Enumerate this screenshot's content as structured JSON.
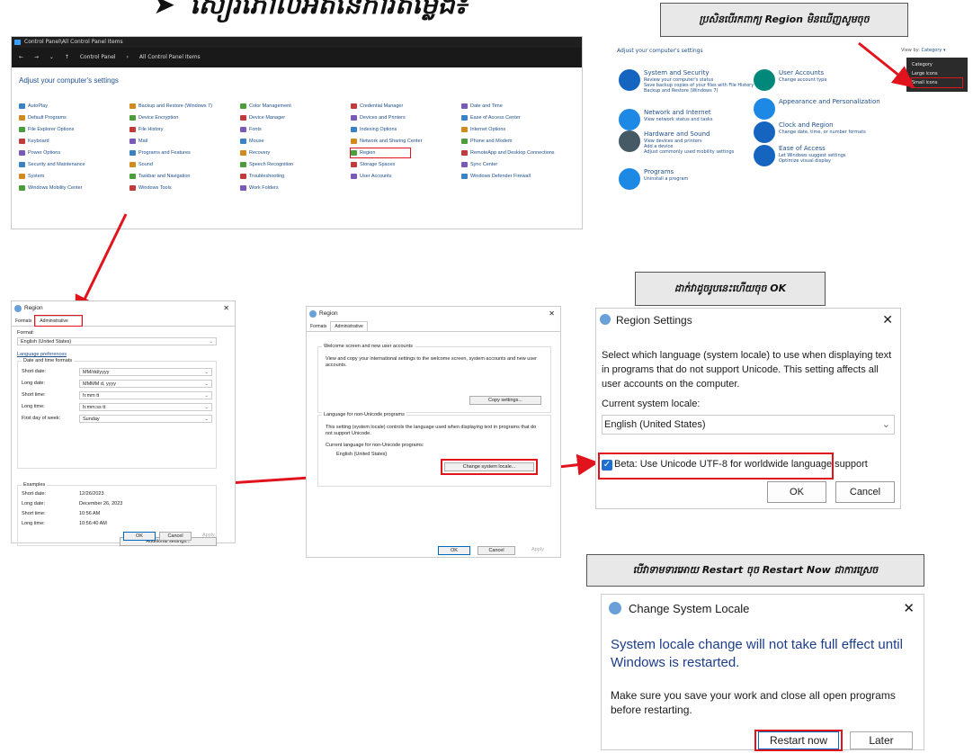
{
  "headline": {
    "arrow": "➤",
    "text": "សៀវភៅលំអិតនៃការតម្លើង៖"
  },
  "control_panel": {
    "window_title": "Control Panel\\All Control Panel Items",
    "breadcrumb": [
      "Control Panel",
      "All Control Panel Items"
    ],
    "heading": "Adjust your computer's settings",
    "items": [
      [
        "AutoPlay",
        "Backup and Restore (Windows 7)",
        "Color Management",
        "Credential Manager",
        "Date and Time"
      ],
      [
        "Default Programs",
        "Device Encryption",
        "Device Manager",
        "Devices and Printers",
        "Ease of Access Center"
      ],
      [
        "File Explorer Options",
        "File History",
        "Fonts",
        "Indexing Options",
        "Internet Options"
      ],
      [
        "Keyboard",
        "Mail",
        "Mouse",
        "Network and Sharing Center",
        "Phone and Modem"
      ],
      [
        "Power Options",
        "Programs and Features",
        "Recovery",
        "Region",
        "RemoteApp and Desktop Connections"
      ],
      [
        "Security and Maintenance",
        "Sound",
        "Speech Recognition",
        "Storage Spaces",
        "Sync Center"
      ],
      [
        "System",
        "Taskbar and Navigation",
        "Troubleshooting",
        "User Accounts",
        "Windows Defender Firewall"
      ],
      [
        "Windows Mobility Center",
        "Windows Tools",
        "Work Folders",
        "",
        ""
      ]
    ]
  },
  "banner1": "ប្រសិនបើរកពាក្យ Region មិនឃើញសូមចុច",
  "category_panel": {
    "heading": "Adjust your computer's settings",
    "view_by_label": "View by:",
    "view_by_value": "Category ▾",
    "menu": [
      "Category",
      "Large icons",
      "Small icons"
    ],
    "groups": [
      {
        "title": "System and Security",
        "links": [
          "Review your computer's status",
          "Save backup copies of your files with File History",
          "Backup and Restore (Windows 7)"
        ]
      },
      {
        "title": "Network and Internet",
        "links": [
          "View network status and tasks"
        ]
      },
      {
        "title": "Hardware and Sound",
        "links": [
          "View devices and printers",
          "Add a device",
          "Adjust commonly used mobility settings"
        ]
      },
      {
        "title": "Programs",
        "links": [
          "Uninstall a program"
        ]
      },
      {
        "title": "User Accounts",
        "links": [
          "Change account type"
        ]
      },
      {
        "title": "Appearance and Personalization",
        "links": []
      },
      {
        "title": "Clock and Region",
        "links": [
          "Change date, time, or number formats"
        ]
      },
      {
        "title": "Ease of Access",
        "links": [
          "Let Windows suggest settings",
          "Optimize visual display"
        ]
      }
    ]
  },
  "region1": {
    "title": "Region",
    "close": "✕",
    "tabs": [
      "Formats",
      "Administrative"
    ],
    "format_label": "Format:",
    "format_value": "English (United States)",
    "lang_pref": "Language preferences",
    "date_time_label": "Date and time formats",
    "fields": [
      {
        "label": "Short date:",
        "value": "MM/dd/yyyy"
      },
      {
        "label": "Long date:",
        "value": "MMMM d, yyyy"
      },
      {
        "label": "Short time:",
        "value": "h:mm tt"
      },
      {
        "label": "Long time:",
        "value": "h:mm:ss tt"
      },
      {
        "label": "First day of week:",
        "value": "Sunday"
      }
    ],
    "examples_label": "Examples",
    "examples": [
      {
        "label": "Short date:",
        "value": "12/26/2023"
      },
      {
        "label": "Long date:",
        "value": "December 26, 2023"
      },
      {
        "label": "Short time:",
        "value": "10:56 AM"
      },
      {
        "label": "Long time:",
        "value": "10:56:40 AM"
      }
    ],
    "additional": "Additional settings...",
    "ok": "OK",
    "cancel": "Cancel",
    "apply": "Apply"
  },
  "region2": {
    "title": "Region",
    "close": "✕",
    "tabs": [
      "Formats",
      "Administrative"
    ],
    "welcome_title": "Welcome screen and new user accounts",
    "welcome_text": "View and copy your international settings to the welcome screen, system accounts and new user accounts.",
    "copy_btn": "Copy settings...",
    "nonuni_title": "Language for non-Unicode programs",
    "nonuni_text": "This setting (system locale) controls the language used when displaying text in programs that do not support Unicode.",
    "current_label": "Current language for non-Unicode programs:",
    "current_value": "English (United States)",
    "change_btn": "Change system locale...",
    "ok": "OK",
    "cancel": "Cancel",
    "apply": "Apply"
  },
  "banner2": "ដាក់វាដូចរូបនេះហើយចុច OK",
  "region_settings": {
    "title": "Region Settings",
    "close": "✕",
    "desc": "Select which language (system locale) to use when displaying text in programs that do not support Unicode. This setting affects all user accounts on the computer.",
    "locale_label": "Current system locale:",
    "locale_value": "English (United States)",
    "beta": "Beta: Use Unicode UTF-8 for worldwide language support",
    "ok": "OK",
    "cancel": "Cancel"
  },
  "banner3": "បើវាទាមទារអោយ Restart ចុច Restart Now ជាការស្រេច",
  "change_locale": {
    "title": "Change System Locale",
    "close": "✕",
    "headline": "System locale change will not take full effect until Windows is restarted.",
    "body": "Make sure you save your work and close all open programs before restarting.",
    "restart": "Restart now",
    "later": "Later"
  },
  "colors": {
    "highlight": "#e1131c",
    "link": "#1e4e8c"
  }
}
